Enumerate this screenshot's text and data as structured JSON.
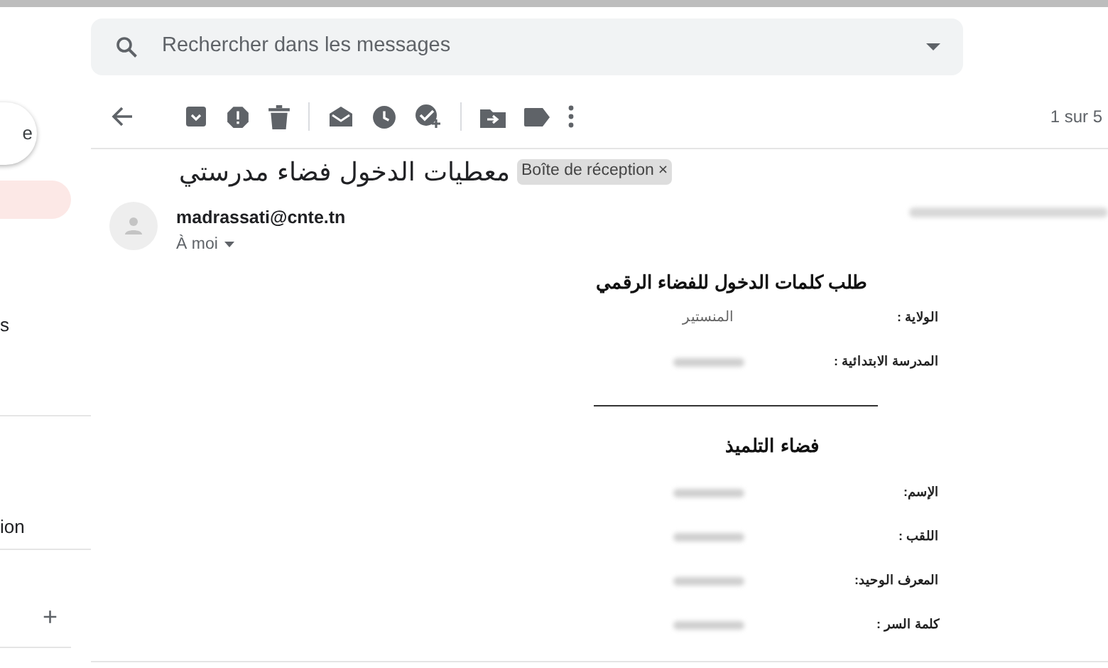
{
  "search": {
    "placeholder": "Rechercher dans les messages"
  },
  "sidebar": {
    "compose_label": "e",
    "items": [
      {
        "selected": true
      },
      {
        "label": "s",
        "selected": false
      },
      {
        "label": "ion",
        "selected": false
      }
    ],
    "add_label": "+"
  },
  "toolbar": {
    "counter": "1 sur 5"
  },
  "message": {
    "subject": "معطيات الدخول فضاء مدرستي",
    "label_chip": "Boîte de réception",
    "label_remove": "×",
    "sender": "madrassati@cnte.tn",
    "recipient": "À moi",
    "date_redacted": true,
    "body": [
      {
        "kind": "heading",
        "text": "طلب كلمات الدخول للفضاء الرقمي"
      },
      {
        "kind": "field",
        "label": "الولاية :",
        "value": "المنستير"
      },
      {
        "kind": "field",
        "label": "المدرسة الابتدائية :",
        "redacted": true
      },
      {
        "kind": "rule"
      },
      {
        "kind": "subheading",
        "text": "فضاء التلميذ"
      },
      {
        "kind": "field",
        "label": "الإسم:",
        "redacted": true
      },
      {
        "kind": "field",
        "label": "اللقب :",
        "redacted": true
      },
      {
        "kind": "field",
        "label": "المعرف الوحيد:",
        "redacted": true
      },
      {
        "kind": "field",
        "label": "كلمة السر :",
        "redacted": true
      }
    ]
  }
}
